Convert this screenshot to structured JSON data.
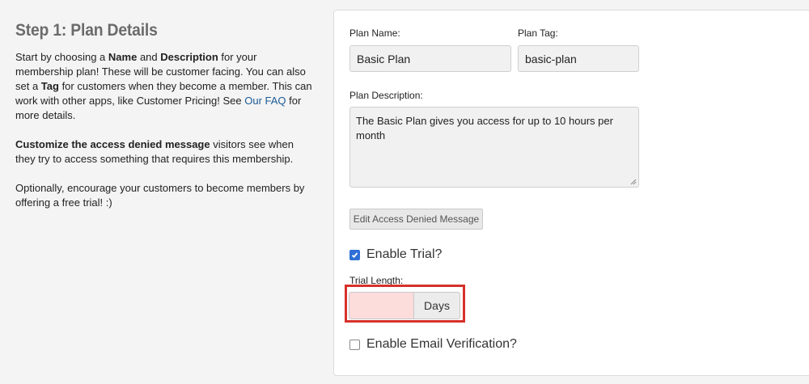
{
  "left": {
    "title": "Step 1: Plan Details",
    "p1": {
      "t1": "Start by choosing a ",
      "b1": "Name",
      "t2": " and ",
      "b2": "Description",
      "t3": " for your membership plan! These will be customer facing. You can also set a ",
      "b3": "Tag",
      "t4": " for customers when they become a member. This can work with other apps, like Customer Pricing! See ",
      "link": "Our FAQ",
      "t5": " for more details."
    },
    "p2": {
      "b1": "Customize the access denied message",
      "t1": " visitors see when they try to access something that requires this membership."
    },
    "p3": "Optionally, encourage your customers to become members by offering a free trial! :)"
  },
  "form": {
    "plan_name_label": "Plan Name:",
    "plan_name_value": "Basic Plan",
    "plan_tag_label": "Plan Tag:",
    "plan_tag_value": "basic-plan",
    "plan_description_label": "Plan Description:",
    "plan_description_value": "The Basic Plan gives you access for up to 10 hours per month",
    "edit_access_button": "Edit Access Denied Message",
    "enable_trial_label": "Enable Trial?",
    "enable_trial_checked": true,
    "trial_length_label": "Trial Length:",
    "trial_length_value": "",
    "trial_unit": "Days",
    "enable_email_label": "Enable Email Verification?",
    "enable_email_checked": false
  },
  "colors": {
    "accent": "#2f6fd6",
    "highlight": "#d6312a",
    "link": "#1a5a96"
  }
}
